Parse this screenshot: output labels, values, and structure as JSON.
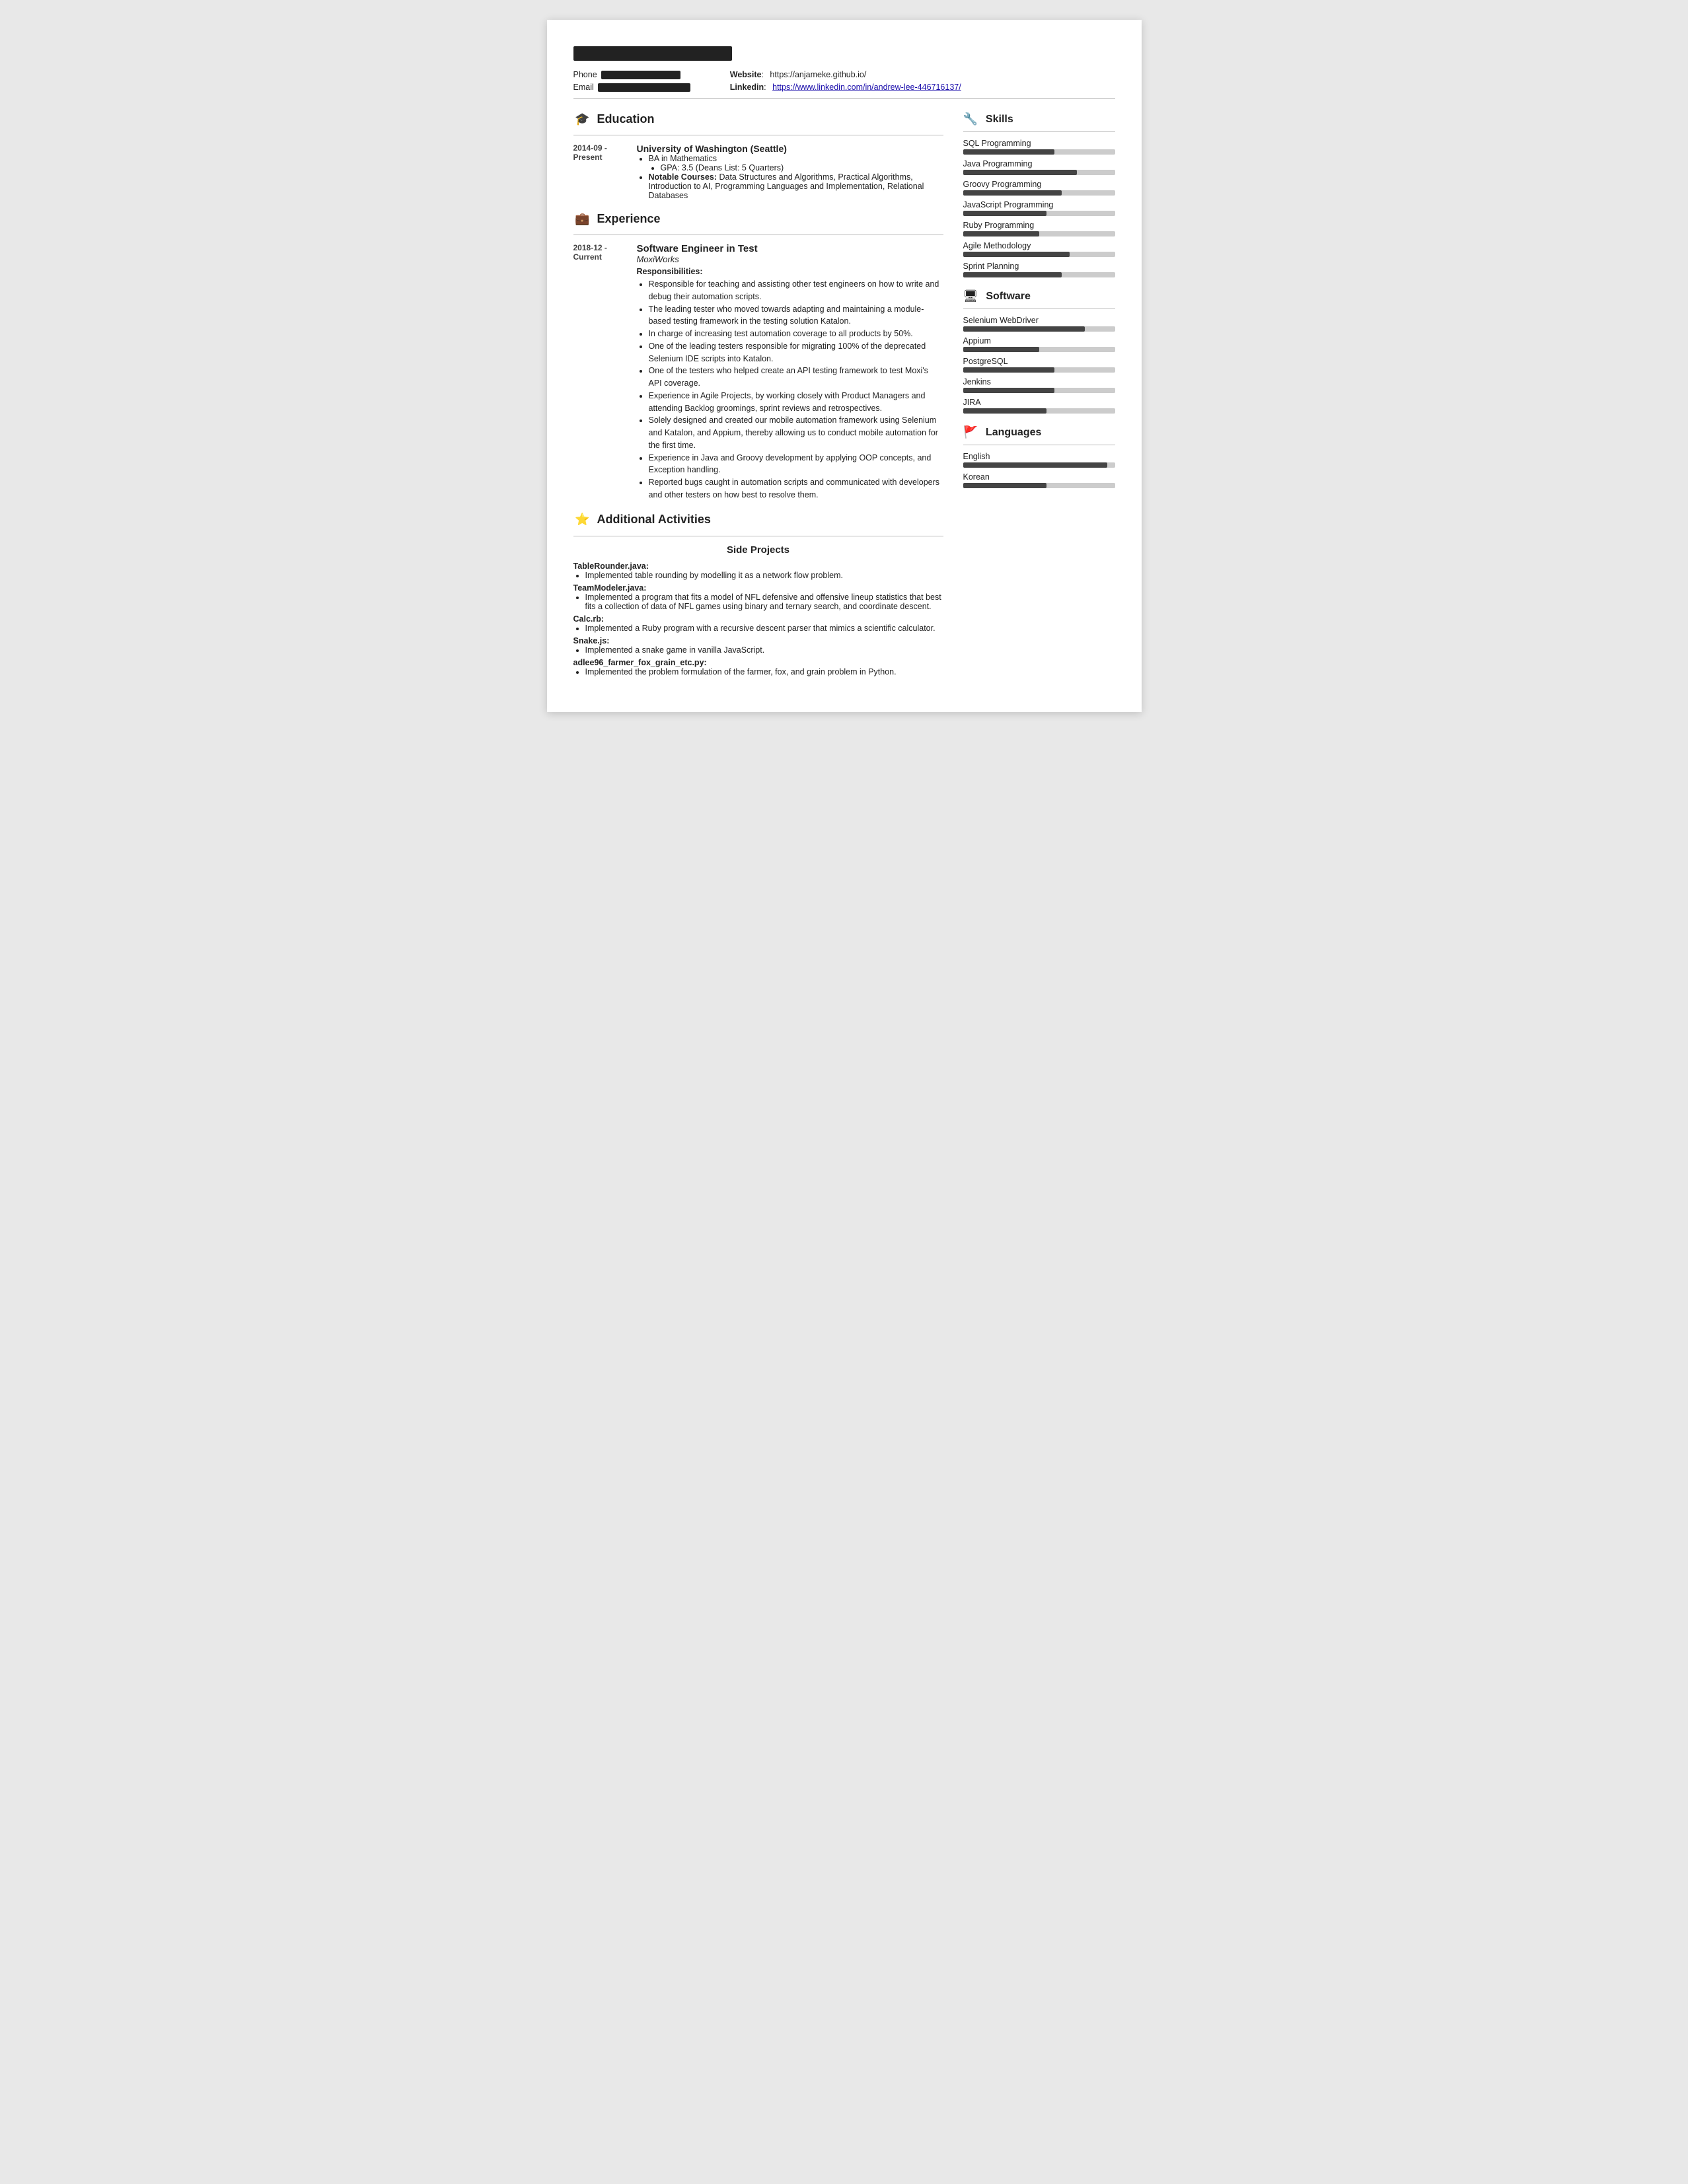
{
  "header": {
    "name_redacted": true,
    "phone_label": "Phone",
    "email_label": "Email",
    "website_label": "Website",
    "website_value": "https://anjameke.github.io/",
    "linkedin_label": "Linkedin",
    "linkedin_url": "https://www.linkedin.com/in/andrew-lee-446716137/",
    "linkedin_display": "https://www.linkedin.com/in/andrew-lee-446716137/"
  },
  "education": {
    "section_title": "Education",
    "icon": "🎓",
    "entries": [
      {
        "date": "2014-09 -\nPresent",
        "school": "University of Washington (Seattle)",
        "degree": "BA in Mathematics",
        "gpa": "GPA: 3.5 (Deans List: 5 Quarters)",
        "notable_label": "Notable Courses:",
        "notable_text": "Data Structures and Algorithms, Practical Algorithms, Introduction to AI, Programming Languages and Implementation, Relational Databases"
      }
    ]
  },
  "experience": {
    "section_title": "Experience",
    "icon": "💼",
    "entries": [
      {
        "date": "2018-12 -\nCurrent",
        "title": "Software Engineer in Test",
        "company": "MoxiWorks",
        "resp_label": "Responsibilities:",
        "bullets": [
          "Responsible for teaching and assisting other test engineers on how to write and debug their automation scripts.",
          "The leading tester who moved towards adapting and maintaining a module-based testing framework in the testing solution Katalon.",
          "In charge of increasing test automation coverage to all products by 50%.",
          "One of the leading testers responsible for migrating 100% of the deprecated Selenium IDE scripts into Katalon.",
          "One of the testers who helped create an API testing framework to test Moxi's API coverage.",
          "Experience in Agile Projects, by working closely with Product Managers and attending Backlog groomings, sprint reviews and retrospectives.",
          "Solely designed and created our mobile automation framework using Selenium and Katalon, and Appium, thereby allowing us to conduct mobile automation for the first time.",
          "Experience in Java and Groovy development by applying OOP concepts, and Exception handling.",
          "Reported bugs caught in automation scripts and communicated with developers and other testers on how best to resolve them."
        ]
      }
    ]
  },
  "additional": {
    "section_title": "Additional Activities",
    "icon": "⭐",
    "side_projects_title": "Side Projects",
    "projects": [
      {
        "title": "TableRounder.java:",
        "bullets": [
          "Implemented table rounding by modelling it as a network flow problem."
        ]
      },
      {
        "title": "TeamModeler.java:",
        "bullets": [
          "Implemented a program that fits a model of NFL defensive and offensive lineup statistics that best fits a collection of data of NFL games using binary and ternary search, and coordinate descent."
        ]
      },
      {
        "title": "Calc.rb:",
        "bullets": [
          "Implemented a Ruby program with a recursive descent parser that mimics a scientific calculator."
        ]
      },
      {
        "title": "Snake.js:",
        "bullets": [
          "Implemented a snake game in vanilla JavaScript."
        ]
      },
      {
        "title": "adlee96_farmer_fox_grain_etc.py:",
        "bullets": [
          "Implemented the problem formulation of the farmer, fox, and grain problem in Python."
        ]
      }
    ]
  },
  "skills": {
    "section_title": "Skills",
    "icon": "🔧",
    "items": [
      {
        "label": "SQL Programming",
        "fill": 60
      },
      {
        "label": "Java Programming",
        "fill": 75
      },
      {
        "label": "Groovy Programming",
        "fill": 65
      },
      {
        "label": "JavaScript Programming",
        "fill": 55
      },
      {
        "label": "Ruby Programming",
        "fill": 50
      },
      {
        "label": "Agile Methodology",
        "fill": 70
      },
      {
        "label": "Sprint Planning",
        "fill": 65
      }
    ]
  },
  "software": {
    "section_title": "Software",
    "icon": "🖥",
    "items": [
      {
        "label": "Selenium WebDriver",
        "fill": 80
      },
      {
        "label": "Appium",
        "fill": 50
      },
      {
        "label": "PostgreSQL",
        "fill": 60
      },
      {
        "label": "Jenkins",
        "fill": 60
      },
      {
        "label": "JIRA",
        "fill": 55
      }
    ]
  },
  "languages": {
    "section_title": "Languages",
    "icon": "🚩",
    "items": [
      {
        "label": "English",
        "fill": 95
      },
      {
        "label": "Korean",
        "fill": 55
      }
    ]
  }
}
